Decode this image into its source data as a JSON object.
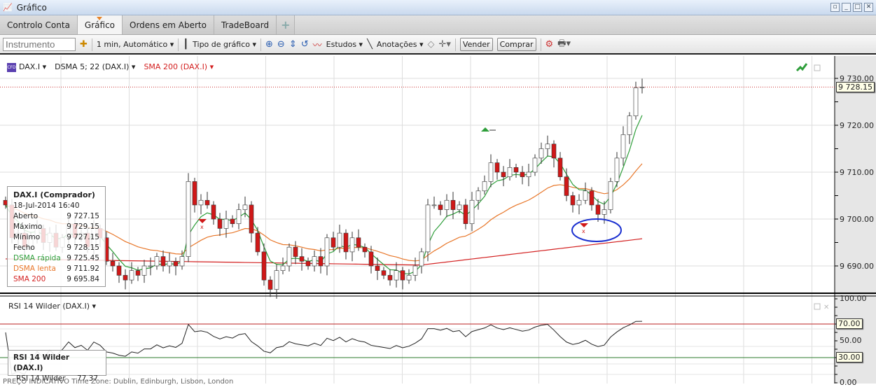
{
  "window": {
    "title": "Gráfico"
  },
  "tabs": [
    {
      "label": "Controlo Conta"
    },
    {
      "label": "Gráfico"
    },
    {
      "label": "Ordens em Aberto"
    },
    {
      "label": "TradeBoard"
    },
    {
      "label": "+"
    }
  ],
  "toolbar": {
    "instrument_placeholder": "Instrumento",
    "interval": "1 min,  Automático ▾",
    "chart_type": "Tipo de gráfico ▾",
    "studies": "Estudos ▾",
    "annotations": "Anotações ▾",
    "sell": "Vender",
    "buy": "Comprar"
  },
  "legend": {
    "symbol": "DAX.I ▾",
    "dsma": "DSMA 5; 22 (DAX.I) ▾",
    "sma": "SMA 200 (DAX.I) ▾"
  },
  "info": {
    "title": "DAX.I (Comprador)",
    "datetime": "18-Jul-2014 16:40",
    "rows": [
      {
        "label": "Aberto",
        "value": "9 727.15"
      },
      {
        "label": "Máximo",
        "value": "9 729.15"
      },
      {
        "label": "Mínimo",
        "value": "9 727.15"
      },
      {
        "label": "Fecho",
        "value": "9 728.15"
      },
      {
        "label": "DSMA rápida",
        "value": "9 725.45"
      },
      {
        "label": "DSMA lenta",
        "value": "9 711.92"
      },
      {
        "label": "SMA 200",
        "value": "9 695.84"
      }
    ]
  },
  "price_axis": {
    "ticks": [
      "9 730.00",
      "9 720.00",
      "9 710.00",
      "9 700.00",
      "9 690.00"
    ],
    "last": "9 728.15"
  },
  "rsi": {
    "legend": "RSI 14 Wilder (DAX.I) ▾",
    "title": "RSI 14 Wilder (DAX.I)",
    "label": "RSI 14 Wilder",
    "value": "77.37",
    "ticks": [
      "100.00",
      "50.00",
      "0.00"
    ],
    "upper": "70.00",
    "lower": "30.00"
  },
  "footer": "PREÇO INDICATIVO    Time Zone: Dublin, Edinburgh, Lisbon, London",
  "colors": {
    "up": "#2e9e3a",
    "down": "#d01818",
    "fast": "#2e9e3a",
    "slow": "#e8772a",
    "sma": "#d32020",
    "annotation": "#1a2fd0"
  },
  "chart_data": {
    "type": "candlestick",
    "ylim": [
      9686,
      9731
    ],
    "closes": [
      9703,
      9696,
      9697,
      9694,
      9696,
      9698,
      9695,
      9697,
      9694,
      9696,
      9699,
      9696,
      9697,
      9694,
      9698,
      9696,
      9691,
      9690,
      9688,
      9687,
      9689,
      9688,
      9690,
      9690,
      9692,
      9690,
      9691,
      9690,
      9692,
      9708,
      9703,
      9704,
      9703,
      9700,
      9698,
      9700,
      9699,
      9702,
      9703,
      9697,
      9693,
      9687,
      9685,
      9689,
      9690,
      9694,
      9692,
      9691,
      9690,
      9692,
      9690,
      9696,
      9694,
      9697,
      9693,
      9696,
      9694,
      9693,
      9690,
      9689,
      9688,
      9687,
      9689,
      9687,
      9688,
      9690,
      9693,
      9703,
      9703,
      9702,
      9704,
      9702,
      9703,
      9699,
      9704,
      9706,
      9708,
      9712,
      9710,
      9709,
      9711,
      9710,
      9709,
      9710,
      9713,
      9715,
      9716,
      9713,
      9709,
      9705,
      9703,
      9704,
      9706,
      9703,
      9701,
      9702,
      9708,
      9713,
      9718,
      9722,
      9728,
      9728.15
    ]
  }
}
